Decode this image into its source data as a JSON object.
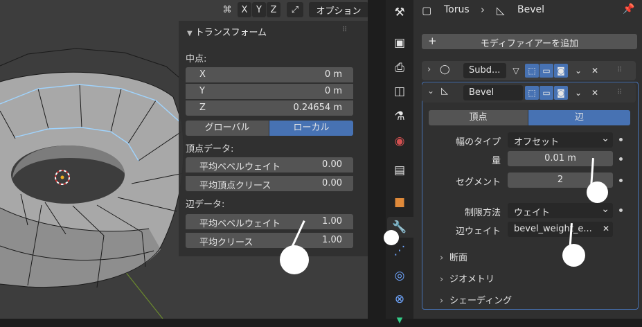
{
  "viewport": {
    "header": {
      "x": "X",
      "y": "Y",
      "z": "Z",
      "options": "オプション"
    }
  },
  "npanel": {
    "title": "トランスフォーム",
    "median": "中点:",
    "x_label": "X",
    "x_value": "0 m",
    "y_label": "Y",
    "y_value": "0 m",
    "z_label": "Z",
    "z_value": "0.24654 m",
    "global": "グローバル",
    "local": "ローカル",
    "vertex_data": "頂点データ:",
    "vbw_label": "平均ベベルウェイト",
    "vbw_value": "0.00",
    "vcrease_label": "平均頂点クリース",
    "vcrease_value": "0.00",
    "edge_data": "辺データ:",
    "ebw_label": "平均ベベルウェイト",
    "ebw_value": "1.00",
    "ecrease_label": "平均クリース",
    "ecrease_value": "1.00"
  },
  "props": {
    "breadcrumb_object": "Torus",
    "breadcrumb_modifier": "Bevel",
    "add_modifier": "モディファイアーを追加",
    "mod1_name": "Subd...",
    "mod2_name": "Bevel",
    "tab_vertex": "頂点",
    "tab_edge": "辺",
    "width_type_label": "幅のタイプ",
    "width_type_value": "オフセット",
    "amount_label": "量",
    "amount_value": "0.01 m",
    "segments_label": "セグメント",
    "segments_value": "2",
    "limit_label": "制限方法",
    "limit_value": "ウェイト",
    "edge_weight_label": "辺ウェイト",
    "edge_weight_value": "bevel_weight_e...",
    "sub_profile": "断面",
    "sub_geometry": "ジオメトリ",
    "sub_shading": "シェーディング"
  },
  "colors": {
    "accent": "#4772b3",
    "selected_edge": "#9fd4ff"
  }
}
